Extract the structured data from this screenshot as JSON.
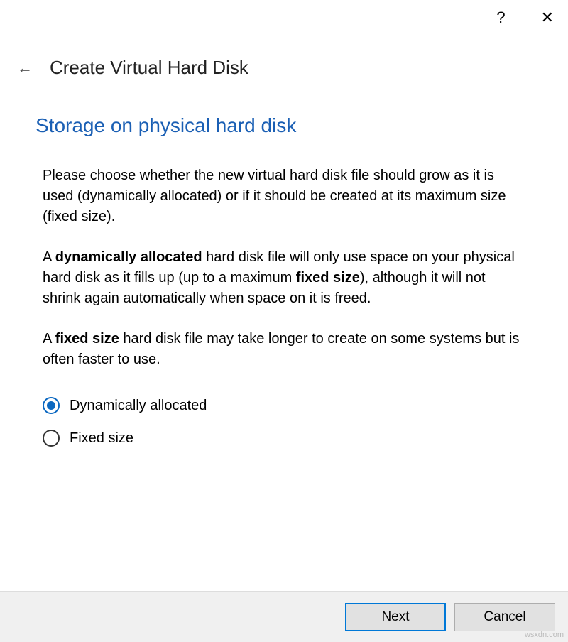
{
  "titlebar": {
    "help": "?",
    "close": "✕"
  },
  "header": {
    "back": "←",
    "title": "Create Virtual Hard Disk"
  },
  "section": {
    "heading": "Storage on physical hard disk"
  },
  "paragraphs": {
    "p1": "Please choose whether the new virtual hard disk file should grow as it is used (dynamically allocated) or if it should be created at its maximum size (fixed size).",
    "p2_a": "A ",
    "p2_b": "dynamically allocated",
    "p2_c": " hard disk file will only use space on your physical hard disk as it fills up (up to a maximum ",
    "p2_d": "fixed size",
    "p2_e": "), although it will not shrink again automatically when space on it is freed.",
    "p3_a": "A ",
    "p3_b": "fixed size",
    "p3_c": " hard disk file may take longer to create on some systems but is often faster to use."
  },
  "options": {
    "dynamic": "Dynamically allocated",
    "fixed": "Fixed size",
    "selected": "dynamic"
  },
  "footer": {
    "next": "Next",
    "cancel": "Cancel"
  },
  "watermark": "wsxdn.com"
}
